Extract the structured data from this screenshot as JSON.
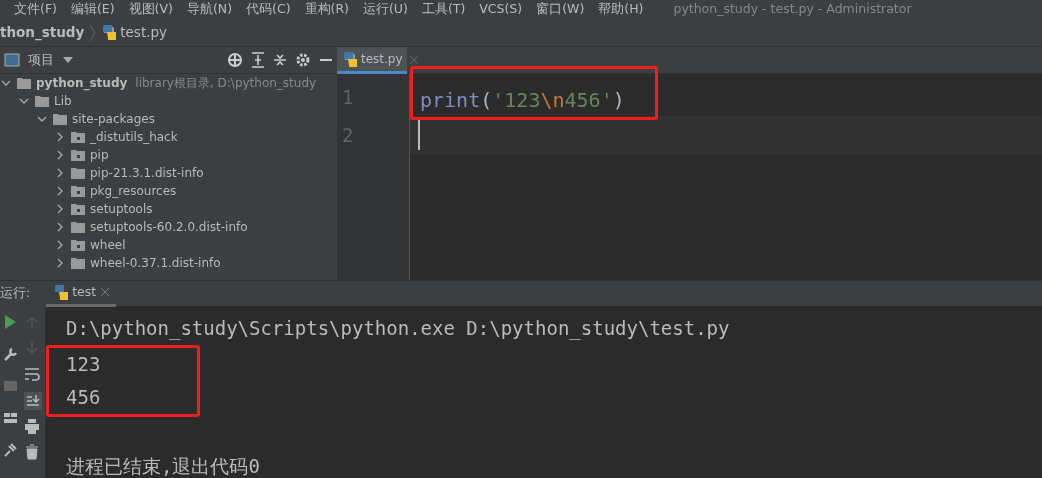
{
  "menu_bar": {
    "items": [
      "文件(F)",
      "编辑(E)",
      "视图(V)",
      "导航(N)",
      "代码(C)",
      "重构(R)",
      "运行(U)",
      "工具(T)",
      "VCS(S)",
      "窗口(W)",
      "帮助(H)"
    ],
    "title": "python_study - test.py - Administrator"
  },
  "breadcrumb": {
    "items": [
      "thon_study",
      "test.py"
    ]
  },
  "project_panel": {
    "title": "项目",
    "tree": [
      {
        "label": "python_study",
        "kind": "folder",
        "bold": true,
        "note": "library根目录,  D:\\python_study",
        "expanded": true,
        "children": [
          {
            "label": "Lib",
            "kind": "folder",
            "expanded": true,
            "children": [
              {
                "label": "site-packages",
                "kind": "folder",
                "expanded": true,
                "children": [
                  {
                    "label": "_distutils_hack",
                    "kind": "package",
                    "expanded": false
                  },
                  {
                    "label": "pip",
                    "kind": "package",
                    "expanded": false
                  },
                  {
                    "label": "pip-21.3.1.dist-info",
                    "kind": "folder",
                    "expanded": false
                  },
                  {
                    "label": "pkg_resources",
                    "kind": "package",
                    "expanded": false
                  },
                  {
                    "label": "setuptools",
                    "kind": "package",
                    "expanded": false
                  },
                  {
                    "label": "setuptools-60.2.0.dist-info",
                    "kind": "folder",
                    "expanded": false
                  },
                  {
                    "label": "wheel",
                    "kind": "package",
                    "expanded": false
                  },
                  {
                    "label": "wheel-0.37.1.dist-info",
                    "kind": "folder",
                    "expanded": false
                  }
                ]
              }
            ]
          }
        ]
      }
    ]
  },
  "editor": {
    "tabs": [
      {
        "label": "test.py",
        "selected": true
      }
    ],
    "lines": [
      {
        "number": "1",
        "highlighted": true,
        "current": false,
        "tokens": [
          {
            "kind": "builtin",
            "text": "print"
          },
          {
            "kind": "paren",
            "text": "("
          },
          {
            "kind": "string",
            "text": "'123"
          },
          {
            "kind": "escape",
            "text": "\\n"
          },
          {
            "kind": "string",
            "text": "456'"
          },
          {
            "kind": "paren",
            "text": ")"
          }
        ]
      },
      {
        "number": "2",
        "highlighted": false,
        "current": true
      }
    ]
  },
  "run_panel": {
    "label": "运行:",
    "tabs": [
      {
        "label": "test",
        "selected": true
      }
    ],
    "console": [
      {
        "text": "D:\\python_study\\Scripts\\python.exe D:\\python_study\\test.py",
        "highlighted": false
      },
      {
        "text": "123",
        "highlighted": true
      },
      {
        "text": "456",
        "highlighted": true
      },
      {
        "text": "进程已结束,退出代码0",
        "highlighted": false,
        "blank_line_before": true
      }
    ]
  }
}
